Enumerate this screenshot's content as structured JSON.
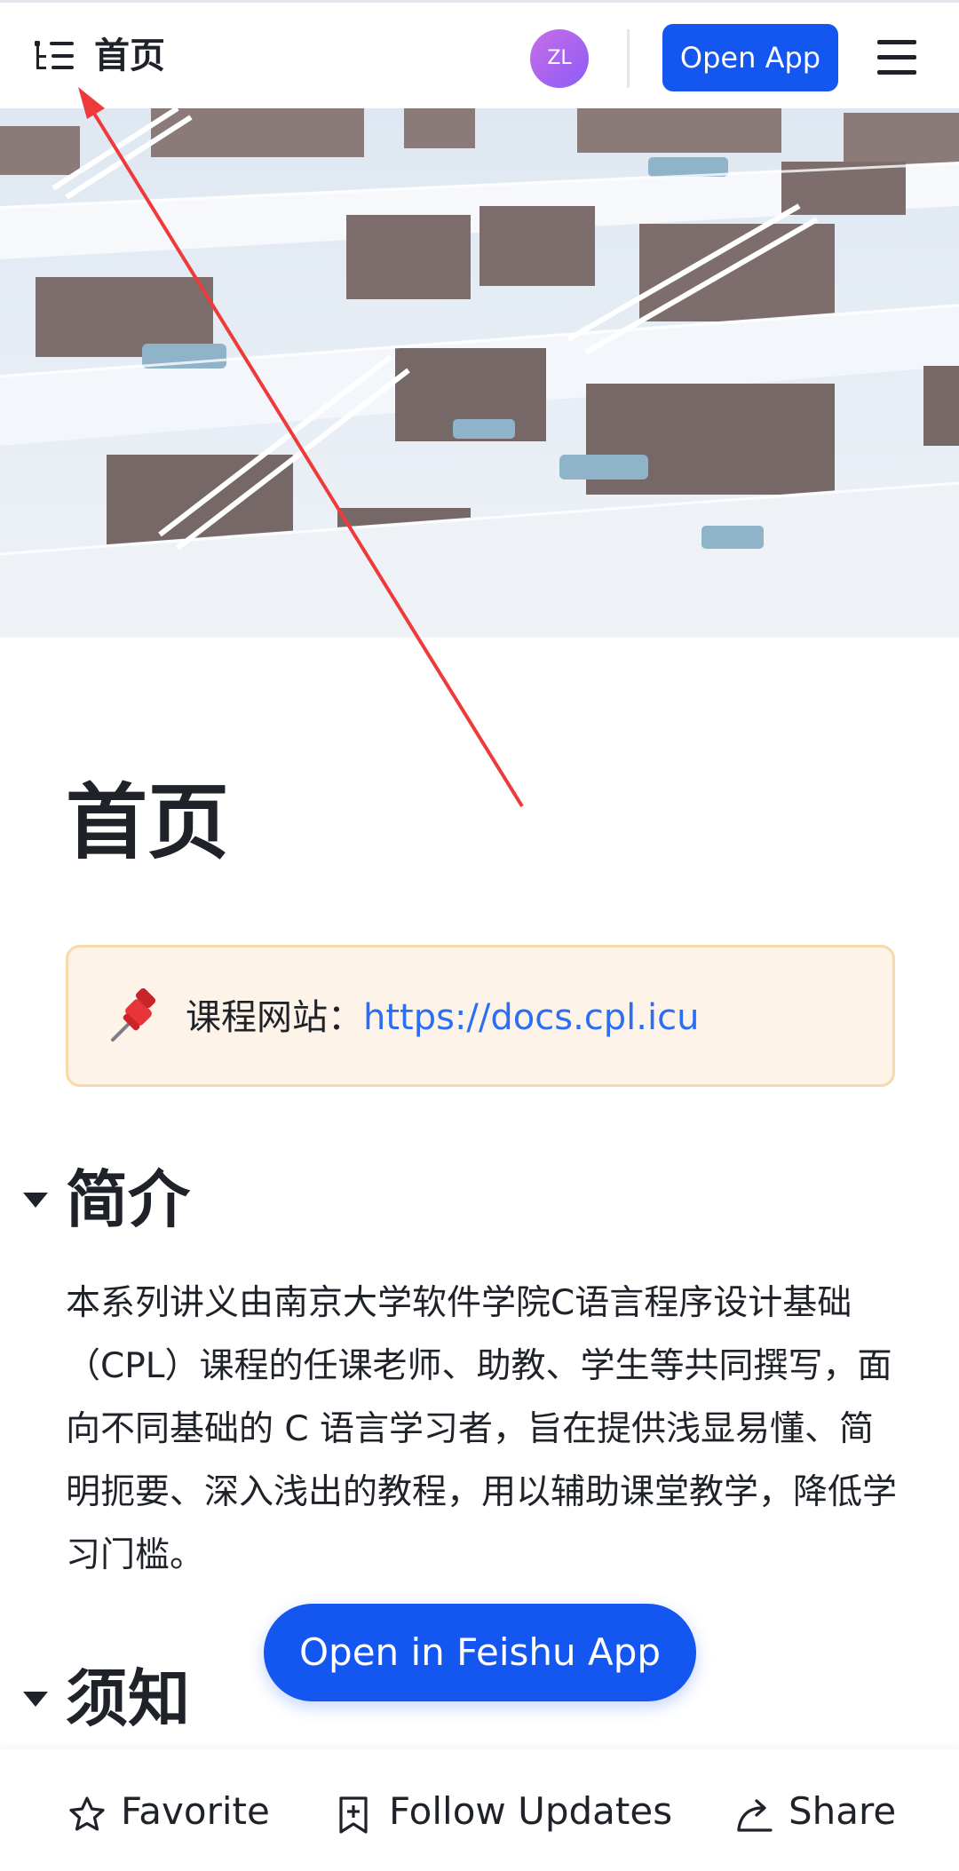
{
  "header": {
    "title": "首页",
    "avatar_initials": "ZL",
    "open_app_label": "Open App",
    "toc_icon": "outline-list-icon",
    "menu_icon": "hamburger-menu-icon"
  },
  "document": {
    "title": "首页",
    "callout": {
      "icon": "pushpin-icon",
      "label": "课程网站：",
      "link": "https://docs.cpl.icu"
    },
    "sections": [
      {
        "heading": "简介",
        "body": "本系列讲义由南京大学软件学院C语言程序设计基础（CPL）课程的任课老师、助教、学生等共同撰写，面向不同基础的 C 语言学习者，旨在提供浅显易懂、简明扼要、深入浅出的教程，用以辅助课堂教学，降低学习门槛。"
      },
      {
        "heading": "须知"
      }
    ]
  },
  "floating_button": {
    "label": "Open in Feishu App"
  },
  "bottom_bar": {
    "favorite": {
      "label": "Favorite",
      "icon": "star-icon"
    },
    "follow": {
      "label": "Follow Updates",
      "icon": "bookmark-add-icon"
    },
    "share": {
      "label": "Share",
      "icon": "share-arrow-icon"
    }
  },
  "colors": {
    "accent": "#1456f0",
    "link": "#2a6ef5",
    "callout_bg": "#fef3e8",
    "callout_border": "#f8d9a8",
    "annotation_arrow": "#ee3a3a"
  }
}
